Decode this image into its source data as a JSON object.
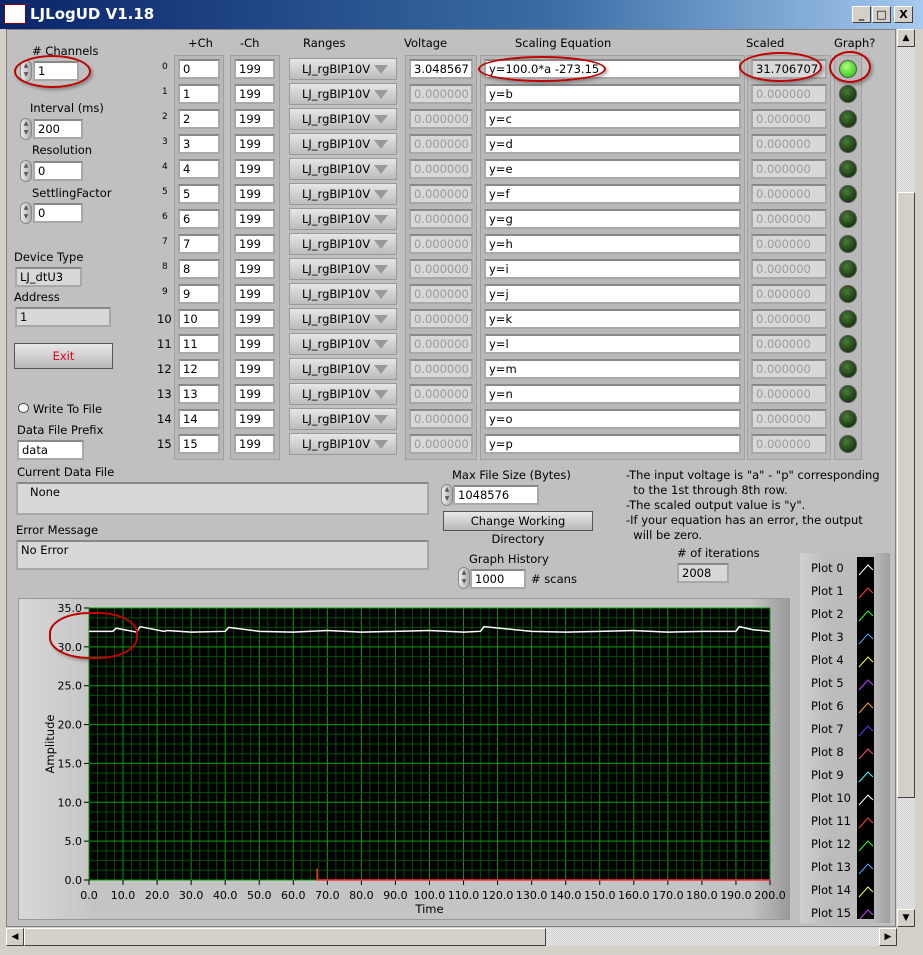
{
  "window": {
    "title": "LJLogUD V1.18",
    "minimize": "_",
    "maximize": "□",
    "close": "X"
  },
  "left": {
    "channels_label": "# Channels",
    "channels_value": "1",
    "interval_label": "Interval (ms)",
    "interval_value": "200",
    "resolution_label": "Resolution",
    "resolution_value": "0",
    "settling_label": "SettlingFactor",
    "settling_value": "0",
    "device_type_label": "Device Type",
    "device_type_value": "LJ_dtU3",
    "address_label": "Address",
    "address_value": "1",
    "exit_label": "Exit",
    "write_to_file_label": "Write To File",
    "prefix_label": "Data File Prefix",
    "prefix_value": "data",
    "current_file_label": "Current Data File",
    "current_file_value": "None",
    "error_label": "Error Message",
    "error_value": "No Error"
  },
  "table": {
    "headers": {
      "pos": "+Ch",
      "neg": "-Ch",
      "range": "Ranges",
      "voltage": "Voltage",
      "equation": "Scaling Equation",
      "scaled": "Scaled",
      "graph": "Graph?"
    },
    "rows": [
      {
        "idx": "0",
        "pos": "0",
        "neg": "199",
        "range": "LJ_rgBIP10V",
        "voltage": "3.048567",
        "equation": "y=100.0*a -273.15",
        "scaled": "31.706707",
        "graph": true
      },
      {
        "idx": "1",
        "pos": "1",
        "neg": "199",
        "range": "LJ_rgBIP10V",
        "voltage": "0.000000",
        "equation": "y=b",
        "scaled": "0.000000",
        "graph": false
      },
      {
        "idx": "2",
        "pos": "2",
        "neg": "199",
        "range": "LJ_rgBIP10V",
        "voltage": "0.000000",
        "equation": "y=c",
        "scaled": "0.000000",
        "graph": false
      },
      {
        "idx": "3",
        "pos": "3",
        "neg": "199",
        "range": "LJ_rgBIP10V",
        "voltage": "0.000000",
        "equation": "y=d",
        "scaled": "0.000000",
        "graph": false
      },
      {
        "idx": "4",
        "pos": "4",
        "neg": "199",
        "range": "LJ_rgBIP10V",
        "voltage": "0.000000",
        "equation": "y=e",
        "scaled": "0.000000",
        "graph": false
      },
      {
        "idx": "5",
        "pos": "5",
        "neg": "199",
        "range": "LJ_rgBIP10V",
        "voltage": "0.000000",
        "equation": "y=f",
        "scaled": "0.000000",
        "graph": false
      },
      {
        "idx": "6",
        "pos": "6",
        "neg": "199",
        "range": "LJ_rgBIP10V",
        "voltage": "0.000000",
        "equation": "y=g",
        "scaled": "0.000000",
        "graph": false
      },
      {
        "idx": "7",
        "pos": "7",
        "neg": "199",
        "range": "LJ_rgBIP10V",
        "voltage": "0.000000",
        "equation": "y=h",
        "scaled": "0.000000",
        "graph": false
      },
      {
        "idx": "8",
        "pos": "8",
        "neg": "199",
        "range": "LJ_rgBIP10V",
        "voltage": "0.000000",
        "equation": "y=i",
        "scaled": "0.000000",
        "graph": false
      },
      {
        "idx": "9",
        "pos": "9",
        "neg": "199",
        "range": "LJ_rgBIP10V",
        "voltage": "0.000000",
        "equation": "y=j",
        "scaled": "0.000000",
        "graph": false
      },
      {
        "idx": "10",
        "pos": "10",
        "neg": "199",
        "range": "LJ_rgBIP10V",
        "voltage": "0.000000",
        "equation": "y=k",
        "scaled": "0.000000",
        "graph": false
      },
      {
        "idx": "11",
        "pos": "11",
        "neg": "199",
        "range": "LJ_rgBIP10V",
        "voltage": "0.000000",
        "equation": "y=l",
        "scaled": "0.000000",
        "graph": false
      },
      {
        "idx": "12",
        "pos": "12",
        "neg": "199",
        "range": "LJ_rgBIP10V",
        "voltage": "0.000000",
        "equation": "y=m",
        "scaled": "0.000000",
        "graph": false
      },
      {
        "idx": "13",
        "pos": "13",
        "neg": "199",
        "range": "LJ_rgBIP10V",
        "voltage": "0.000000",
        "equation": "y=n",
        "scaled": "0.000000",
        "graph": false
      },
      {
        "idx": "14",
        "pos": "14",
        "neg": "199",
        "range": "LJ_rgBIP10V",
        "voltage": "0.000000",
        "equation": "y=o",
        "scaled": "0.000000",
        "graph": false
      },
      {
        "idx": "15",
        "pos": "15",
        "neg": "199",
        "range": "LJ_rgBIP10V",
        "voltage": "0.000000",
        "equation": "y=p",
        "scaled": "0.000000",
        "graph": false
      }
    ]
  },
  "mid": {
    "max_file_label": "Max File Size (Bytes)",
    "max_file_value": "1048576",
    "change_dir_label": "Change Working Directory",
    "history_label": "Graph History",
    "history_value": "1000",
    "history_unit": "# scans",
    "iterations_label": "# of iterations",
    "iterations_value": "2008",
    "notes": [
      "-The input voltage is \"a\" - \"p\" corresponding",
      "  to the 1st through 8th row.",
      "-The scaled output value is \"y\".",
      "-If your equation has an error, the output",
      "  will be zero."
    ]
  },
  "chart_data": {
    "type": "line",
    "xlabel": "Time",
    "ylabel": "Amplitude",
    "xlim": [
      0,
      200
    ],
    "ylim": [
      0,
      35
    ],
    "grid": true,
    "xticks": [
      "0.0",
      "10.0",
      "20.0",
      "30.0",
      "40.0",
      "50.0",
      "60.0",
      "70.0",
      "80.0",
      "90.0",
      "100.0",
      "110.0",
      "120.0",
      "130.0",
      "140.0",
      "150.0",
      "160.0",
      "170.0",
      "180.0",
      "190.0",
      "200.0"
    ],
    "yticks": [
      "0.0",
      "5.0",
      "10.0",
      "15.0",
      "20.0",
      "25.0",
      "30.0",
      "35.0"
    ],
    "legend_position": "right",
    "series": [
      {
        "name": "Plot 0",
        "color": "#ffffff",
        "x": [
          0,
          7,
          8,
          14,
          15,
          22,
          23,
          30,
          40,
          41,
          50,
          60,
          70,
          80,
          90,
          100,
          110,
          115,
          116,
          130,
          140,
          150,
          160,
          170,
          180,
          190,
          191,
          195,
          200
        ],
        "y": [
          32.0,
          32.0,
          32.4,
          31.9,
          32.6,
          32.0,
          32.1,
          31.9,
          32.0,
          32.5,
          32.0,
          31.9,
          32.1,
          31.9,
          32.0,
          32.1,
          31.9,
          32.0,
          32.6,
          32.0,
          31.9,
          32.0,
          32.1,
          31.9,
          32.0,
          32.0,
          32.6,
          32.2,
          32.0
        ]
      },
      {
        "name": "Plot 1",
        "color": "#ff3030",
        "x": [
          67,
          200
        ],
        "y": [
          0,
          0
        ]
      }
    ],
    "legend": [
      {
        "name": "Plot 0",
        "color": "#ffffff"
      },
      {
        "name": "Plot 1",
        "color": "#ff4040"
      },
      {
        "name": "Plot 2",
        "color": "#30ff30"
      },
      {
        "name": "Plot 3",
        "color": "#40b0ff"
      },
      {
        "name": "Plot 4",
        "color": "#ffff40"
      },
      {
        "name": "Plot 5",
        "color": "#c040ff"
      },
      {
        "name": "Plot 6",
        "color": "#ffa020"
      },
      {
        "name": "Plot 7",
        "color": "#4040ff"
      },
      {
        "name": "Plot 8",
        "color": "#ff4090"
      },
      {
        "name": "Plot 9",
        "color": "#40ffff"
      },
      {
        "name": "Plot 10",
        "color": "#ffffff"
      },
      {
        "name": "Plot 11",
        "color": "#ff4040"
      },
      {
        "name": "Plot 12",
        "color": "#30ff30"
      },
      {
        "name": "Plot 13",
        "color": "#40b0ff"
      },
      {
        "name": "Plot 14",
        "color": "#ffff40"
      },
      {
        "name": "Plot 15",
        "color": "#c040ff"
      }
    ]
  }
}
